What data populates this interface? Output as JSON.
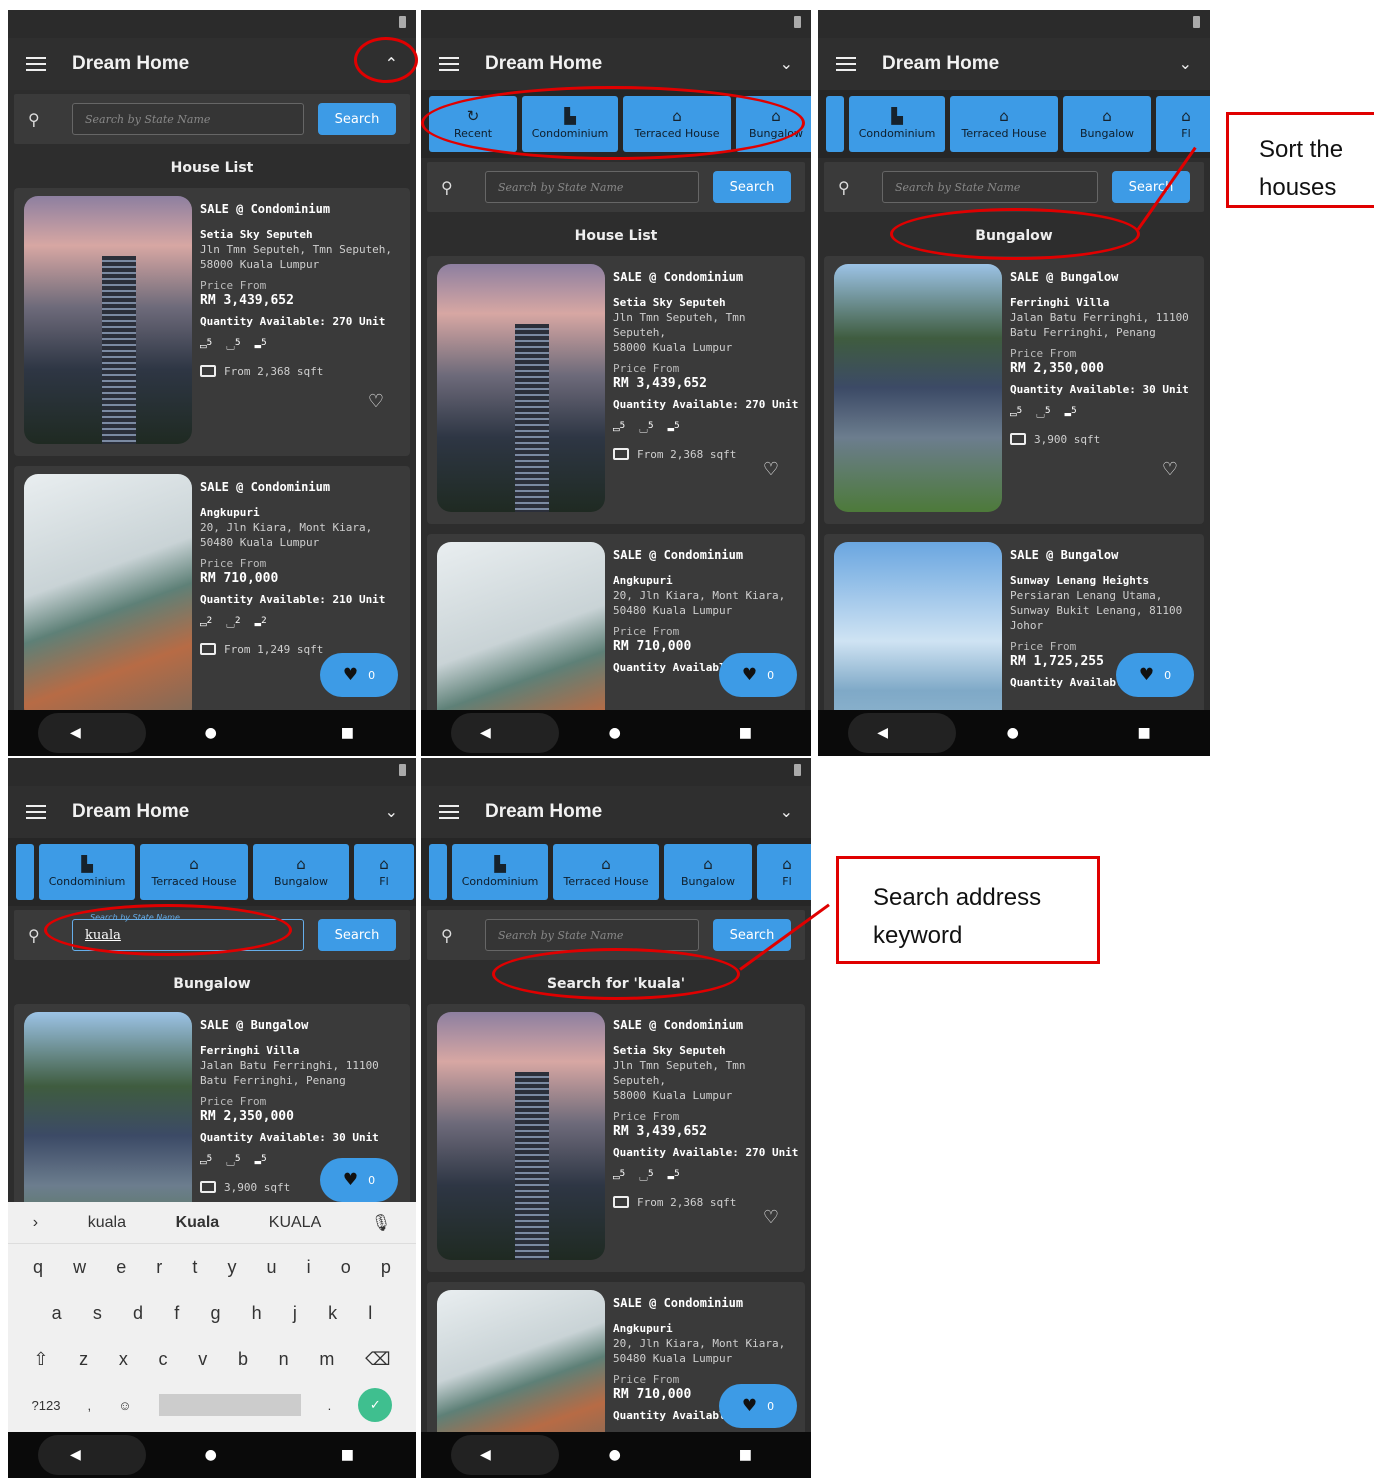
{
  "app": {
    "title": "Dream Home"
  },
  "search": {
    "placeholder": "Search by State Name",
    "button": "Search",
    "typed_value": "kuala",
    "float_label": "Search by State Name"
  },
  "categories": [
    "Recent",
    "Condominium",
    "Terraced House",
    "Bungalow",
    "Fl"
  ],
  "sections": {
    "house_list": "House List",
    "bungalow": "Bungalow",
    "search_for": "Search for 'kuala'"
  },
  "listings": {
    "setia": {
      "tag": "SALE @ Condominium",
      "name": "Setia Sky Seputeh",
      "addr1": "Jln Tmn Seputeh, Tmn Seputeh,",
      "addr2": "58000 Kuala Lumpur",
      "price_label": "Price From",
      "price": "RM 3,439,652",
      "qty": "Quantity Available: 270 Unit",
      "bed": "5",
      "bath": "5",
      "car": "5",
      "sqft": "From 2,368 sqft"
    },
    "angkupuri": {
      "tag": "SALE @ Condominium",
      "name": "Angkupuri",
      "addr1": "20, Jln Kiara, Mont Kiara,",
      "addr2": "50480 Kuala Lumpur",
      "price_label": "Price From",
      "price": "RM 710,000",
      "qty": "Quantity Available: 210 Unit",
      "qty_cut": "Quantity Available:",
      "bed": "2",
      "bath": "2",
      "car": "2",
      "sqft": "From 1,249 sqft"
    },
    "ferringhi": {
      "tag": "SALE @ Bungalow",
      "name": "Ferringhi Villa",
      "addr1": "Jalan Batu Ferringhi, 11100",
      "addr2": "Batu Ferringhi, Penang",
      "price_label": "Price From",
      "price": "RM 2,350,000",
      "qty": "Quantity Available: 30 Unit",
      "bed": "5",
      "bath": "5",
      "car": "5",
      "sqft": "3,900 sqft"
    },
    "sunway": {
      "tag": "SALE @ Bungalow",
      "name": "Sunway Lenang Heights",
      "addr1": "Persiaran Lenang Utama,",
      "addr2": "Sunway Bukit Lenang, 81100",
      "addr3": "Johor",
      "price_label": "Price From",
      "price": "RM 1,725,255",
      "qty_cut": "Quantity Available:"
    }
  },
  "fab": {
    "count": "0"
  },
  "keyboard": {
    "suggestions": [
      "kuala",
      "Kuala",
      "KUALA"
    ],
    "row1": [
      "q",
      "w",
      "e",
      "r",
      "t",
      "y",
      "u",
      "i",
      "o",
      "p"
    ],
    "row2": [
      "a",
      "s",
      "d",
      "f",
      "g",
      "h",
      "j",
      "k",
      "l"
    ],
    "row3": [
      "z",
      "x",
      "c",
      "v",
      "b",
      "n",
      "m"
    ],
    "sym": "?123"
  },
  "callouts": {
    "sort": "Sort the houses",
    "search": "Search address keyword"
  },
  "colors": {
    "accent": "#3d9be6",
    "annotation": "#e00000",
    "background": "#2d2d2d"
  }
}
